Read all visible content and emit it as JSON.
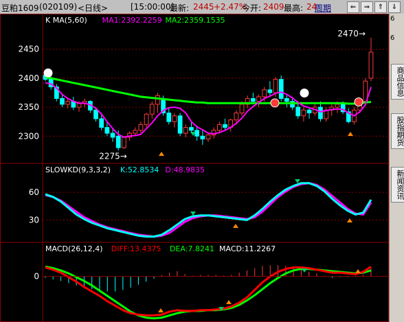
{
  "header": {
    "symbol": "豆粕1609",
    "code": "(020109)",
    "period": "<日线>",
    "time": "[15:00:00]",
    "latest_label": "最新:",
    "latest_value": "2445",
    "change": "+2.47%",
    "open_label": "今开:",
    "open_value": "2409",
    "high_label": "最高:",
    "high_value": "24",
    "period_button": "周期",
    "nav_buttons": [
      "⇐",
      "⇒",
      "⇑",
      "⇓"
    ]
  },
  "sidebar": {
    "tabs": [
      "商品信息",
      "股指期货",
      "新闻资讯"
    ],
    "numbers": [
      "6",
      "6"
    ]
  },
  "colors": {
    "up": "#ff3c3c",
    "down": "#00ffff",
    "ma5": "#ff00ff",
    "ma60": "#00ff00",
    "k": "#00ffff",
    "d": "#ff00ff",
    "diff": "#ff0000",
    "dea": "#00ff00",
    "grid": "#8b0000"
  },
  "chart_data": [
    {
      "type": "candlestick",
      "title": "K  MA(5,60)",
      "series": [
        {
          "name": "MA1:2392.2259",
          "color": "#ff00ff"
        },
        {
          "name": "MA2:2359.1535",
          "color": "#00ff00"
        }
      ],
      "y_ticks": [
        2300,
        2350,
        2400,
        2450
      ],
      "ylim": [
        2260,
        2490
      ],
      "annotations": [
        {
          "text": "2470",
          "value": 2470
        },
        {
          "text": "2275",
          "value": 2275
        }
      ],
      "ohlc": [
        [
          2405,
          2410,
          2395,
          2398
        ],
        [
          2400,
          2403,
          2380,
          2385
        ],
        [
          2385,
          2390,
          2360,
          2365
        ],
        [
          2365,
          2372,
          2350,
          2355
        ],
        [
          2355,
          2365,
          2348,
          2360
        ],
        [
          2360,
          2368,
          2345,
          2350
        ],
        [
          2350,
          2360,
          2342,
          2356
        ],
        [
          2356,
          2365,
          2350,
          2360
        ],
        [
          2360,
          2362,
          2340,
          2345
        ],
        [
          2345,
          2350,
          2325,
          2330
        ],
        [
          2330,
          2340,
          2310,
          2315
        ],
        [
          2315,
          2325,
          2300,
          2305
        ],
        [
          2305,
          2312,
          2290,
          2298
        ],
        [
          2300,
          2310,
          2275,
          2280
        ],
        [
          2280,
          2300,
          2278,
          2298
        ],
        [
          2298,
          2308,
          2292,
          2305
        ],
        [
          2305,
          2315,
          2300,
          2310
        ],
        [
          2310,
          2325,
          2305,
          2320
        ],
        [
          2320,
          2340,
          2315,
          2338
        ],
        [
          2338,
          2360,
          2330,
          2355
        ],
        [
          2355,
          2375,
          2340,
          2370
        ],
        [
          2365,
          2370,
          2335,
          2340
        ],
        [
          2340,
          2350,
          2320,
          2325
        ],
        [
          2325,
          2340,
          2315,
          2335
        ],
        [
          2335,
          2340,
          2300,
          2305
        ],
        [
          2305,
          2320,
          2298,
          2315
        ],
        [
          2315,
          2325,
          2305,
          2310
        ],
        [
          2310,
          2318,
          2292,
          2300
        ],
        [
          2300,
          2310,
          2285,
          2295
        ],
        [
          2295,
          2305,
          2290,
          2302
        ],
        [
          2302,
          2315,
          2296,
          2310
        ],
        [
          2310,
          2325,
          2305,
          2320
        ],
        [
          2320,
          2330,
          2310,
          2315
        ],
        [
          2315,
          2330,
          2308,
          2328
        ],
        [
          2328,
          2345,
          2320,
          2340
        ],
        [
          2340,
          2360,
          2335,
          2355
        ],
        [
          2355,
          2370,
          2348,
          2365
        ],
        [
          2365,
          2375,
          2355,
          2360
        ],
        [
          2360,
          2372,
          2350,
          2368
        ],
        [
          2368,
          2385,
          2360,
          2380
        ],
        [
          2380,
          2395,
          2370,
          2375
        ],
        [
          2375,
          2402,
          2368,
          2398
        ],
        [
          2398,
          2405,
          2360,
          2365
        ],
        [
          2365,
          2372,
          2350,
          2360
        ],
        [
          2360,
          2368,
          2345,
          2350
        ],
        [
          2350,
          2360,
          2330,
          2335
        ],
        [
          2335,
          2350,
          2325,
          2345
        ],
        [
          2345,
          2350,
          2330,
          2340
        ],
        [
          2340,
          2355,
          2335,
          2350
        ],
        [
          2350,
          2360,
          2325,
          2330
        ],
        [
          2330,
          2350,
          2325,
          2345
        ],
        [
          2345,
          2355,
          2335,
          2350
        ],
        [
          2350,
          2360,
          2340,
          2355
        ],
        [
          2355,
          2360,
          2338,
          2342
        ],
        [
          2342,
          2348,
          2322,
          2325
        ],
        [
          2325,
          2350,
          2320,
          2345
        ],
        [
          2345,
          2365,
          2340,
          2360
        ],
        [
          2360,
          2400,
          2355,
          2395
        ],
        [
          2400,
          2470,
          2395,
          2445
        ]
      ],
      "ma5": [
        2392,
        2390,
        2383,
        2372,
        2365,
        2360,
        2357,
        2357,
        2354,
        2348,
        2338,
        2325,
        2313,
        2303,
        2298,
        2300,
        2301,
        2303,
        2313,
        2323,
        2335,
        2344,
        2349,
        2350,
        2348,
        2340,
        2325,
        2316,
        2311,
        2305,
        2304,
        2306,
        2310,
        2315,
        2322,
        2331,
        2343,
        2351,
        2358,
        2365,
        2369,
        2374,
        2376,
        2372,
        2366,
        2358,
        2352,
        2349,
        2346,
        2342,
        2344,
        2346,
        2347,
        2346,
        2340,
        2335,
        2342,
        2354,
        2385
      ],
      "ma60": [
        2402,
        2400,
        2398,
        2396,
        2394,
        2392,
        2390,
        2388,
        2386,
        2384,
        2382,
        2380,
        2378,
        2376,
        2374,
        2372,
        2370,
        2368,
        2367,
        2366,
        2365,
        2364,
        2363,
        2362,
        2361,
        2360,
        2359,
        2358,
        2358,
        2357,
        2357,
        2357,
        2357,
        2357,
        2357,
        2357,
        2357,
        2357,
        2357,
        2357,
        2357,
        2357,
        2357,
        2357,
        2357,
        2357,
        2357,
        2357,
        2357,
        2357,
        2357,
        2357,
        2357,
        2357,
        2356,
        2356,
        2357,
        2358,
        2359
      ]
    },
    {
      "type": "line",
      "title": "SLOWKD(9,3,3,2)",
      "series": [
        {
          "name": "K:52.8534",
          "color": "#00ffff"
        },
        {
          "name": "D:48.9835",
          "color": "#ff00ff"
        }
      ],
      "y_ticks": [
        30,
        60
      ],
      "ylim": [
        8,
        78
      ],
      "k": [
        58,
        55,
        50,
        43,
        36,
        31,
        27,
        24,
        21,
        19,
        17,
        15,
        13,
        12,
        12,
        14,
        19,
        25,
        31,
        34,
        35,
        35,
        34,
        33,
        32,
        31,
        30,
        35,
        42,
        50,
        57,
        63,
        67,
        70,
        70,
        67,
        61,
        53,
        46,
        40,
        36,
        38,
        52
      ],
      "d": [
        57,
        55,
        51,
        45,
        39,
        33,
        29,
        25,
        22,
        20,
        18,
        16,
        14,
        13,
        12,
        13,
        16,
        22,
        28,
        32,
        34,
        35,
        35,
        34,
        33,
        32,
        31,
        33,
        39,
        47,
        55,
        61,
        66,
        69,
        70,
        68,
        63,
        56,
        49,
        42,
        37,
        36,
        49
      ]
    },
    {
      "type": "bar",
      "title": "MACD(26,12,4)",
      "series": [
        {
          "name": "DIFF:13.4375",
          "color": "#ff0000"
        },
        {
          "name": "DEA:7.8241",
          "color": "#00ff00"
        },
        {
          "name": "MACD:11.2267",
          "color": "#ffffff"
        }
      ],
      "y_ticks": [
        0
      ],
      "ylim": [
        -58,
        28
      ],
      "diff": [
        12,
        9,
        5,
        -1,
        -7,
        -14,
        -20,
        -26,
        -33,
        -39,
        -45,
        -49,
        -51,
        -52,
        -52,
        -51,
        -47,
        -45,
        -46,
        -46,
        -45,
        -45,
        -44,
        -43,
        -40,
        -35,
        -28,
        -18,
        -8,
        0,
        6,
        10,
        12,
        12,
        11,
        9,
        7,
        5,
        5,
        4,
        3,
        6,
        13
      ],
      "dea": [
        13,
        11,
        8,
        4,
        -1,
        -6,
        -12,
        -19,
        -26,
        -33,
        -40,
        -47,
        -52,
        -55,
        -56,
        -55,
        -52,
        -49,
        -47,
        -46,
        -46,
        -45,
        -45,
        -44,
        -42,
        -38,
        -32,
        -25,
        -17,
        -9,
        -2,
        4,
        8,
        10,
        10,
        9,
        8,
        7,
        6,
        5,
        4,
        5,
        8
      ],
      "macd": [
        -2,
        -4,
        -6,
        -9,
        -12,
        -15,
        -17,
        -19,
        -20,
        -20,
        -18,
        -15,
        -11,
        -7,
        -3,
        2,
        5,
        7,
        3,
        1,
        2,
        2,
        2,
        1,
        2,
        5,
        8,
        11,
        14,
        15,
        15,
        14,
        12,
        10,
        6,
        4,
        1,
        -2,
        -1,
        -1,
        -1,
        2,
        11
      ]
    }
  ]
}
